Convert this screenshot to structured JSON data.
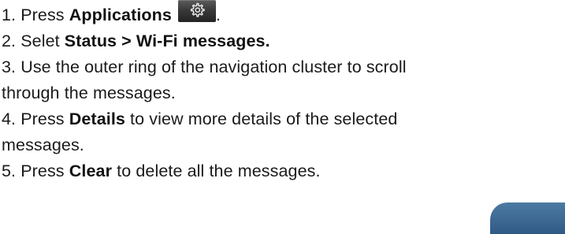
{
  "steps": [
    {
      "prefix": "1. Press ",
      "bold": "Applications",
      "suffix": ".",
      "icon": "gear-icon"
    },
    {
      "prefix": "2. Selet ",
      "bold": "Status > Wi-Fi messages."
    },
    {
      "text": "3. Use the outer ring of the navigation cluster to scroll",
      "continuation": "through the messages."
    },
    {
      "prefix": "4. Press ",
      "bold": "Details",
      "suffix": " to view more details of the selected",
      "continuation": "messages."
    },
    {
      "prefix": "5. Press ",
      "bold": "Clear",
      "suffix": " to delete all the messages."
    }
  ]
}
